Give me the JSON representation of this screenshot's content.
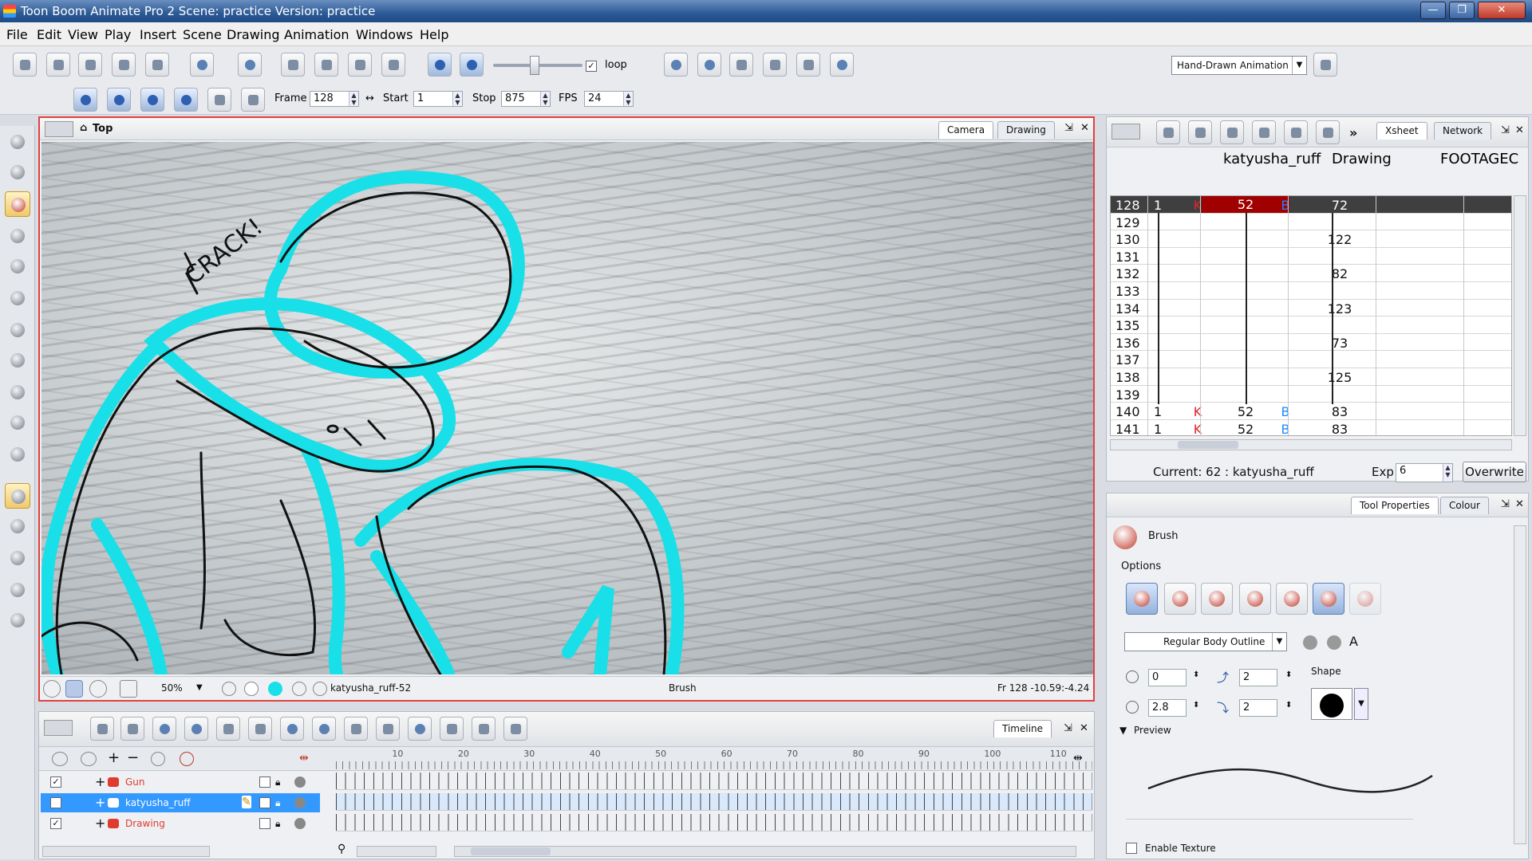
{
  "window": {
    "title": "Toon Boom Animate Pro 2 Scene: practice Version: practice",
    "minimize": "—",
    "maximize": "❐",
    "close": "✕"
  },
  "menu": [
    "File",
    "Edit",
    "View",
    "Play",
    "Insert",
    "Scene",
    "Drawing",
    "Animation",
    "Windows",
    "Help"
  ],
  "toolbar": {
    "loop_label": "loop",
    "loop_checked": true,
    "workspace": "Hand-Drawn Animation"
  },
  "playback": {
    "frame_label": "Frame",
    "frame_value": "128",
    "start_label": "Start",
    "start_value": "1",
    "stop_label": "Stop",
    "stop_value": "875",
    "fps_label": "FPS",
    "fps_value": "24"
  },
  "camera_view": {
    "breadcrumb": "Top",
    "tabs": [
      "Camera",
      "Drawing"
    ],
    "sketch_text": "CRACK!",
    "zoom": "50%",
    "drawing_name": "katyusha_ruff-52",
    "tool": "Brush",
    "frame_coords": "Fr 128 -10.59:-4.24"
  },
  "xsheet": {
    "tabs": [
      "Xsheet",
      "Network"
    ],
    "columns": [
      "katyusha_ruff",
      "Drawing",
      "FOOTAGEC"
    ],
    "rows": [
      {
        "frame": "128",
        "c0": "1",
        "k": "K",
        "c1": "52",
        "b": "B",
        "c2": "72",
        "current": true
      },
      {
        "frame": "129",
        "c0": "",
        "k": "",
        "c1": "",
        "b": "",
        "c2": ""
      },
      {
        "frame": "130",
        "c0": "",
        "k": "",
        "c1": "",
        "b": "",
        "c2": "122"
      },
      {
        "frame": "131",
        "c0": "",
        "k": "",
        "c1": "",
        "b": "",
        "c2": ""
      },
      {
        "frame": "132",
        "c0": "",
        "k": "",
        "c1": "",
        "b": "",
        "c2": "82"
      },
      {
        "frame": "133",
        "c0": "",
        "k": "",
        "c1": "",
        "b": "",
        "c2": ""
      },
      {
        "frame": "134",
        "c0": "",
        "k": "",
        "c1": "",
        "b": "",
        "c2": "123"
      },
      {
        "frame": "135",
        "c0": "",
        "k": "",
        "c1": "",
        "b": "",
        "c2": ""
      },
      {
        "frame": "136",
        "c0": "",
        "k": "",
        "c1": "",
        "b": "",
        "c2": "73"
      },
      {
        "frame": "137",
        "c0": "",
        "k": "",
        "c1": "",
        "b": "",
        "c2": ""
      },
      {
        "frame": "138",
        "c0": "",
        "k": "",
        "c1": "",
        "b": "",
        "c2": "125"
      },
      {
        "frame": "139",
        "c0": "",
        "k": "",
        "c1": "",
        "b": "",
        "c2": ""
      },
      {
        "frame": "140",
        "c0": "1",
        "k": "K",
        "c1": "52",
        "b": "B",
        "c2": "83"
      },
      {
        "frame": "141",
        "c0": "1",
        "k": "K",
        "c1": "52",
        "b": "B",
        "c2": "83"
      }
    ],
    "current_label": "Current: 62 : katyusha_ruff",
    "exp_label": "Exp",
    "exp_value": "6",
    "mode_button": "Overwrite"
  },
  "tool_properties": {
    "tabs": [
      "Tool Properties",
      "Colour"
    ],
    "tool_name": "Brush",
    "options_label": "Options",
    "preset": "Regular Body Outline",
    "min_size": "0",
    "max_size": "2.8",
    "smoothing": "2",
    "contour": "2",
    "shape_label": "Shape",
    "preview_label": "Preview",
    "enable_texture_label": "Enable Texture"
  },
  "timeline": {
    "tab": "Timeline",
    "ruler": [
      "10",
      "20",
      "30",
      "40",
      "50",
      "60",
      "70",
      "80",
      "90",
      "100",
      "110"
    ],
    "layers": [
      {
        "name": "Gun",
        "color": "#e03b2f",
        "selected": false
      },
      {
        "name": "katyusha_ruff",
        "color": "#ffffff",
        "selected": true
      },
      {
        "name": "Drawing",
        "color": "#e03b2f",
        "selected": false
      }
    ]
  },
  "colors": {
    "accent": "#3399ff",
    "cyan_stroke": "#19e0e8",
    "frame_border": "#e04141",
    "current_row": "#3f3f3f",
    "current_cell": "#a00000"
  }
}
